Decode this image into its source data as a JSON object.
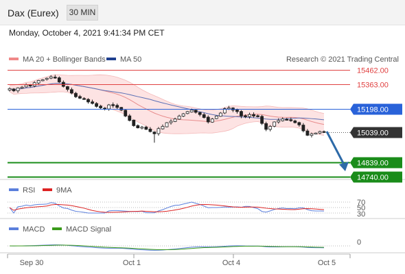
{
  "header": {
    "instrument": "Dax (Eurex)",
    "timeframe": "30 MIN",
    "datetime": "Monday, October 4, 2021 9:41:34 PM CET"
  },
  "legend": {
    "ma20": "MA 20 + Bollinger Bands",
    "ma50": "MA 50",
    "copyright": "Research © 2021 Trading Central"
  },
  "colors": {
    "resistance": "#e04040",
    "pivot": "#2962d9",
    "support": "#1a8c1a",
    "last_price_tag": "#333333",
    "arrow": "#2d6aa8",
    "bollinger_fill": "#fde3e3",
    "ma20": "#e88c8c",
    "ma50": "#5a6fb5",
    "rsi": "#5b7fdc",
    "rsi_ma": "#dd2222",
    "macd": "#5b7fdc",
    "macd_signal": "#3a9a1a"
  },
  "levels": {
    "r2": "15462.00",
    "r1": "15363.00",
    "pivot": "15198.00",
    "last": "15039.00",
    "s1": "14839.00",
    "s2": "14740.00"
  },
  "rsi_panel": {
    "legend_rsi": "RSI",
    "legend_ma": "9MA",
    "levels": [
      "70",
      "50",
      "30"
    ]
  },
  "macd_panel": {
    "legend_macd": "MACD",
    "legend_signal": "MACD Signal",
    "zero_label": "0"
  },
  "x_axis": {
    "labels": [
      "Sep 30",
      "Oct 1",
      "Oct 4",
      "Oct 5"
    ]
  },
  "chart_data": {
    "type": "candlestick",
    "timeframe_minutes": 30,
    "y_range": [
      14700,
      15500
    ],
    "closes": [
      15335,
      15320,
      15340,
      15345,
      15360,
      15355,
      15375,
      15390,
      15395,
      15405,
      15415,
      15410,
      15380,
      15350,
      15330,
      15305,
      15280,
      15270,
      15265,
      15245,
      15235,
      15215,
      15205,
      15200,
      15225,
      15220,
      15208,
      15190,
      15150,
      15120,
      15085,
      15070,
      15075,
      15060,
      15045,
      15030,
      15065,
      15080,
      15105,
      15115,
      15130,
      15150,
      15165,
      15180,
      15190,
      15175,
      15160,
      15140,
      15110,
      15130,
      15150,
      15170,
      15200,
      15205,
      15190,
      15180,
      15150,
      15145,
      15160,
      15150,
      15145,
      15100,
      15060,
      15080,
      15110,
      15120,
      15130,
      15128,
      15120,
      15105,
      15090,
      15050,
      15020,
      15030,
      15035,
      15045,
      15040
    ],
    "support": [
      14839,
      14740
    ],
    "resistance": [
      15462,
      15363
    ],
    "pivot": 15198,
    "last": 15039,
    "rsi_levels": [
      70,
      50,
      30
    ],
    "series": [
      {
        "name": "MA 20 + Bollinger Bands"
      },
      {
        "name": "MA 50"
      },
      {
        "name": "RSI"
      },
      {
        "name": "9MA"
      },
      {
        "name": "MACD"
      },
      {
        "name": "MACD Signal"
      }
    ]
  }
}
